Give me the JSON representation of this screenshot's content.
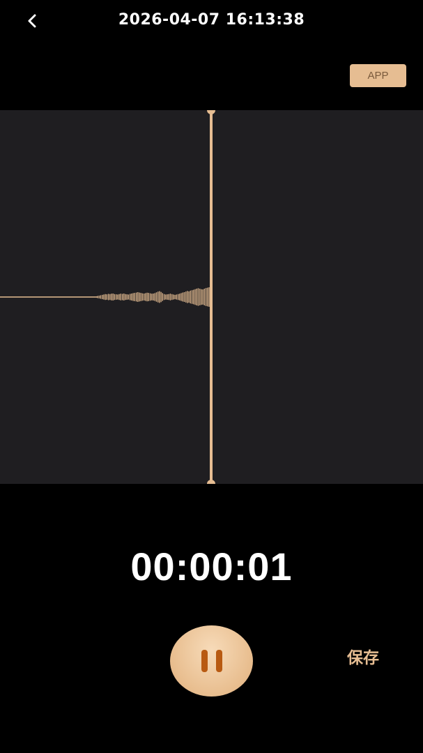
{
  "header": {
    "title": "2026-04-07 16:13:38",
    "back_icon": "chevron-left-icon"
  },
  "app_button": {
    "label": "APP"
  },
  "recorder": {
    "timer": "00:00:01",
    "save_label": "保存",
    "pause_icon": "pause-icon"
  },
  "colors": {
    "background": "#000000",
    "wave_panel": "#1f1e21",
    "accent": "#e6bd92",
    "pause_glyph": "#b85a12"
  },
  "waveform": {
    "amplitudes": [
      0.1,
      0.14,
      0.18,
      0.22,
      0.26,
      0.3,
      0.28,
      0.32,
      0.3,
      0.34,
      0.36,
      0.3,
      0.28,
      0.26,
      0.3,
      0.34,
      0.32,
      0.36,
      0.3,
      0.28,
      0.26,
      0.32,
      0.36,
      0.4,
      0.42,
      0.46,
      0.5,
      0.46,
      0.42,
      0.38,
      0.36,
      0.4,
      0.44,
      0.42,
      0.38,
      0.34,
      0.36,
      0.4,
      0.48,
      0.55,
      0.6,
      0.52,
      0.4,
      0.3,
      0.26,
      0.28,
      0.3,
      0.34,
      0.3,
      0.26,
      0.22,
      0.26,
      0.3,
      0.34,
      0.4,
      0.46,
      0.5,
      0.56,
      0.62,
      0.58,
      0.66,
      0.7,
      0.74,
      0.8,
      0.86,
      0.9,
      0.86,
      0.8,
      0.78,
      0.86,
      0.92,
      0.96,
      1.0
    ]
  }
}
